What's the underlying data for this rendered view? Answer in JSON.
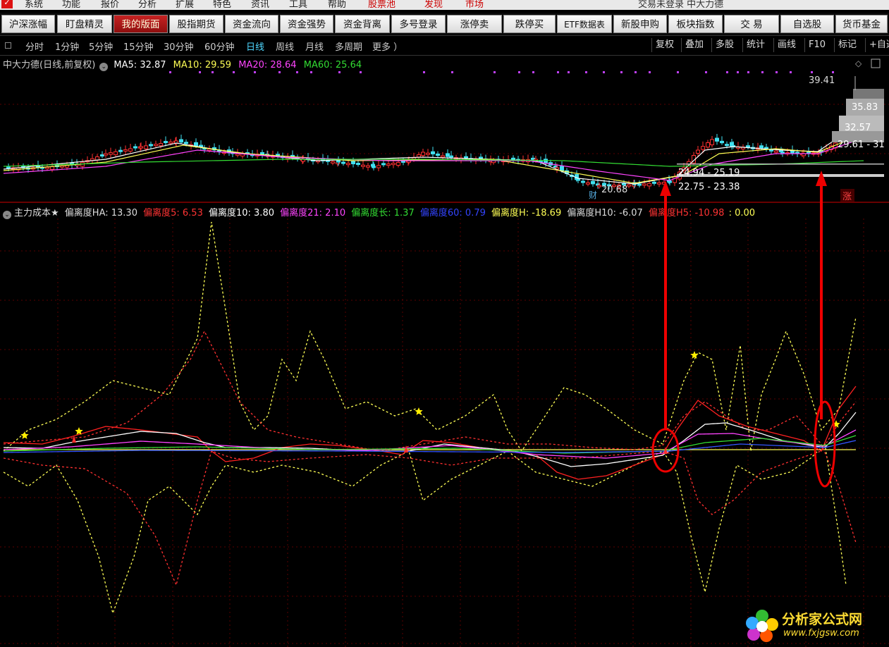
{
  "menu": {
    "items": [
      "系统",
      "功能",
      "报价",
      "分析",
      "扩展",
      "特色",
      "资讯",
      "工具",
      "帮助",
      "股票池",
      "发现",
      "市场"
    ],
    "status": "交易未登录  中大力德"
  },
  "toolbar": {
    "buttons": [
      "沪深涨幅",
      "盯盘精灵",
      "我的版面",
      "股指期货",
      "资金流向",
      "资金强势",
      "资金背离",
      "多号登录",
      "涨停卖",
      "跌停买",
      "ETF数据表",
      "新股申购",
      "板块指数",
      "交 易",
      "自选股",
      "货币基金"
    ],
    "active_index": 2
  },
  "periods": {
    "items": [
      "分时",
      "1分钟",
      "5分钟",
      "15分钟",
      "30分钟",
      "60分钟",
      "日线",
      "周线",
      "月线",
      "多周期",
      "更多 ）"
    ],
    "selected": "日线"
  },
  "right_tools": [
    "复权",
    "叠加",
    "多股",
    "统计",
    "画线",
    "F10",
    "标记",
    "+自选"
  ],
  "price_panel": {
    "title": "中大力德(日线,前复权)",
    "ma": [
      {
        "label": "MA5: 32.87",
        "color": "#ffffff"
      },
      {
        "label": "MA10: 29.59",
        "color": "#ffff55"
      },
      {
        "label": "MA20: 28.64",
        "color": "#ff44ff"
      },
      {
        "label": "MA60: 25.64",
        "color": "#33dd33"
      }
    ],
    "labels": {
      "high": "39.41",
      "p1": "35.83",
      "p2": "32.57",
      "p3": "29.61 - 31",
      "r1": "24.94 - 25.19",
      "r2": "22.75 - 23.38",
      "low": "20.68",
      "cai": "财",
      "zhang": "涨"
    }
  },
  "indicator_panel": {
    "title": "主力成本★",
    "items": [
      {
        "label": "偏离度HA: 13.30",
        "color": "#dddddd"
      },
      {
        "label": "偏离度5: 6.53",
        "color": "#ff3333"
      },
      {
        "label": "偏离度10: 3.80",
        "color": "#ffffff"
      },
      {
        "label": "偏离度21: 2.10",
        "color": "#ff44ff"
      },
      {
        "label": "偏离度长: 1.37",
        "color": "#33dd33"
      },
      {
        "label": "偏离度60: 0.79",
        "color": "#3344ff"
      },
      {
        "label": "偏离度H: -18.69",
        "color": "#ffff55"
      },
      {
        "label": "偏离度H10: -6.07",
        "color": "#dddddd"
      },
      {
        "label": "偏离度H5: -10.98",
        "color": "#ff3333"
      },
      {
        "label": ": 0.00",
        "color": "#ffff55"
      }
    ]
  },
  "watermark": {
    "name": "分析家公式网",
    "url": "www.fxjgsw.com"
  }
}
